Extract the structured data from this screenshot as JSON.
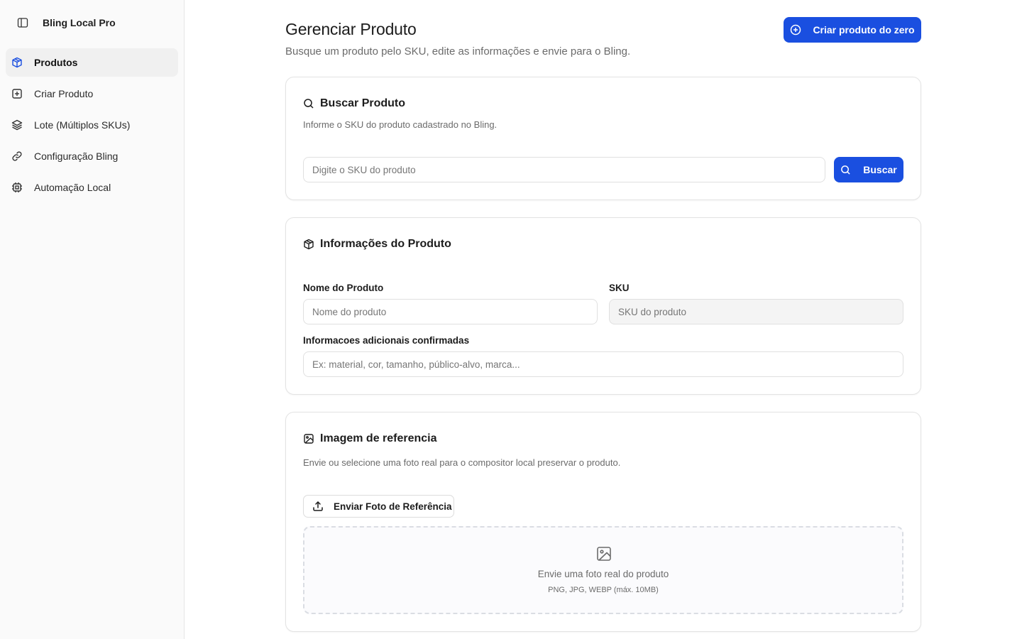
{
  "app": {
    "name": "Bling Local Pro"
  },
  "sidebar": {
    "items": [
      {
        "label": "Produtos",
        "icon": "package-icon",
        "active": true
      },
      {
        "label": "Criar Produto",
        "icon": "plus-square-icon",
        "active": false
      },
      {
        "label": "Lote (Múltiplos SKUs)",
        "icon": "layers-icon",
        "active": false
      },
      {
        "label": "Configuração Bling",
        "icon": "link-icon",
        "active": false
      },
      {
        "label": "Automação Local",
        "icon": "cpu-icon",
        "active": false
      }
    ]
  },
  "header": {
    "title": "Gerenciar Produto",
    "subtitle": "Busque um produto pelo SKU, edite as informações e envie para o Bling.",
    "create_button": "Criar produto do zero"
  },
  "search_card": {
    "title": "Buscar Produto",
    "description": "Informe o SKU do produto cadastrado no Bling.",
    "input_placeholder": "Digite o SKU do produto",
    "input_value": "",
    "button_label": "Buscar"
  },
  "info_card": {
    "title": "Informações do Produto",
    "name_label": "Nome do Produto",
    "name_placeholder": "Nome do produto",
    "sku_label": "SKU",
    "sku_placeholder": "SKU do produto",
    "extra_label": "Informacoes adicionais confirmadas",
    "extra_placeholder": "Ex: material, cor, tamanho, público-alvo, marca..."
  },
  "image_card": {
    "title": "Imagem de referencia",
    "description": "Envie ou selecione uma foto real para o compositor local preservar o produto.",
    "upload_button": "Enviar Foto de Referência",
    "dropzone_title": "Envie uma foto real do produto",
    "dropzone_hint": "PNG, JPG, WEBP (máx. 10MB)"
  },
  "colors": {
    "primary": "#1a4fe0",
    "sidebar_bg": "#fafafa",
    "active_icon": "#1a4fe0"
  }
}
